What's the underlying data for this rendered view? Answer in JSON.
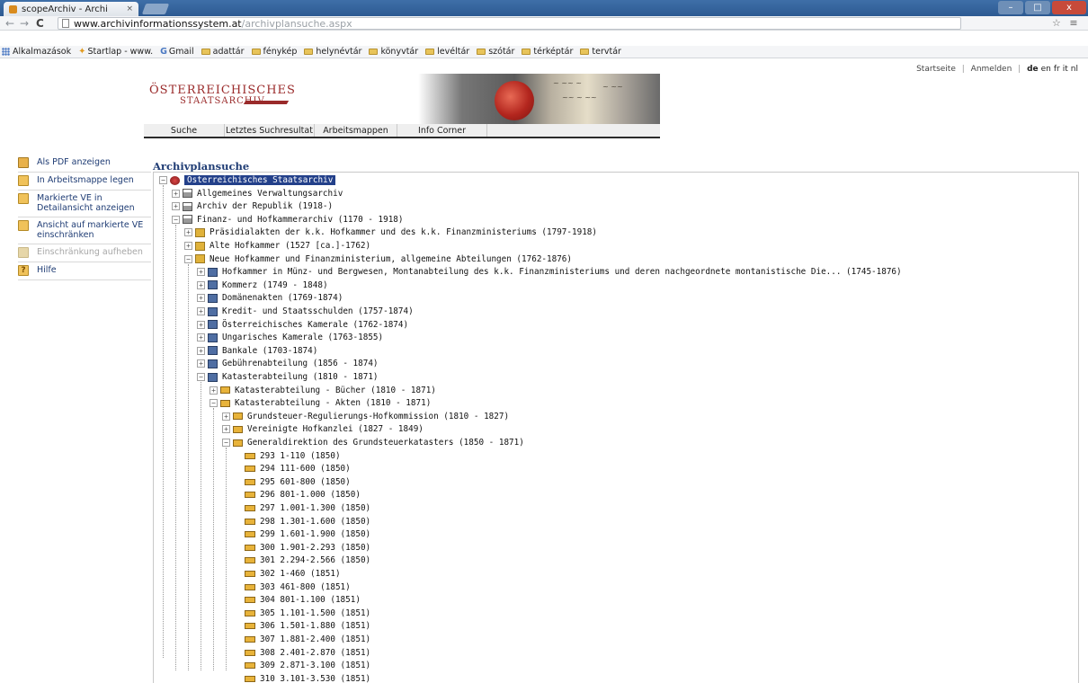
{
  "browser": {
    "tab_title": "scopeArchiv - Archi",
    "tab_close": "×",
    "url_host": "www.archivinformationssystem.at",
    "url_path": "/archivplansuche.aspx",
    "window_controls": {
      "min": "–",
      "max": "□",
      "close": "x"
    },
    "nav_glyphs": {
      "back": "←",
      "forward": "→",
      "reload": "C"
    },
    "toolbar_glyphs": "☆ ≡",
    "bookmarks": [
      {
        "label": "Alkalmazások",
        "icon": "apps-icon"
      },
      {
        "label": "Startlap - www.",
        "icon": "star-icon"
      },
      {
        "label": "Gmail",
        "icon": "google-icon"
      },
      {
        "label": "adattár",
        "icon": "folder-icon"
      },
      {
        "label": "fénykép",
        "icon": "folder-icon"
      },
      {
        "label": "helynévtár",
        "icon": "folder-icon"
      },
      {
        "label": "könyvtár",
        "icon": "folder-icon"
      },
      {
        "label": "levéltár",
        "icon": "folder-icon"
      },
      {
        "label": "szótár",
        "icon": "folder-icon"
      },
      {
        "label": "térképtár",
        "icon": "folder-icon"
      },
      {
        "label": "tervtár",
        "icon": "folder-icon"
      }
    ]
  },
  "header": {
    "startseite": "Startseite",
    "separator": "|",
    "anmelden": "Anmelden",
    "languages": [
      "de",
      "en",
      "fr",
      "it",
      "nl"
    ],
    "active_language": "de",
    "logo_line1": "ÖSTERREICHISCHES",
    "logo_line2": "STAATSARCHIV",
    "nav": [
      "Suche",
      "Letztes Suchresultat",
      "Arbeitsmappen",
      "Info Corner"
    ]
  },
  "sidebar": [
    {
      "label": "Als PDF anzeigen",
      "icon": "pdf-icon",
      "enabled": true
    },
    {
      "label": "In Arbeitsmappe legen",
      "icon": "folder-add-icon",
      "enabled": true
    },
    {
      "label": "Markierte VE in Detailansicht anzeigen",
      "icon": "detail-view-icon",
      "enabled": true
    },
    {
      "label": "Ansicht auf markierte VE einschränken",
      "icon": "filter-icon",
      "enabled": true
    },
    {
      "label": "Einschränkung aufheben",
      "icon": "filter-off-icon",
      "enabled": false
    },
    {
      "label": "Hilfe",
      "icon": "help-icon",
      "enabled": true
    }
  ],
  "main": {
    "title": "Archivplansuche",
    "tree": [
      {
        "depth": 0,
        "exp": "-",
        "icon": "root",
        "label": "Österreichisches Staatsarchiv",
        "selected": true
      },
      {
        "depth": 1,
        "exp": "+",
        "icon": "bldg",
        "label": "Allgemeines Verwaltungsarchiv"
      },
      {
        "depth": 1,
        "exp": "+",
        "icon": "bldg",
        "label": "Archiv der Republik (1918-)"
      },
      {
        "depth": 1,
        "exp": "-",
        "icon": "bldg",
        "label": "Finanz- und Hofkammerarchiv (1170 - 1918)"
      },
      {
        "depth": 2,
        "exp": "+",
        "icon": "gold",
        "label": "Präsidialakten der k.k. Hofkammer und des k.k. Finanzministeriums (1797-1918)"
      },
      {
        "depth": 2,
        "exp": "+",
        "icon": "gold",
        "label": "Alte Hofkammer (1527 [ca.]-1762)"
      },
      {
        "depth": 2,
        "exp": "-",
        "icon": "gold",
        "label": "Neue Hofkammer und Finanzministerium, allgemeine Abteilungen (1762-1876)"
      },
      {
        "depth": 3,
        "exp": "+",
        "icon": "blue",
        "label": "Hofkammer in Münz- und Bergwesen, Montanabteilung des k.k. Finanzministeriums und deren nachgeordnete montanistische Die... (1745-1876)"
      },
      {
        "depth": 3,
        "exp": "+",
        "icon": "blue",
        "label": "Kommerz (1749 - 1848)"
      },
      {
        "depth": 3,
        "exp": "+",
        "icon": "blue",
        "label": "Domänenakten (1769-1874)"
      },
      {
        "depth": 3,
        "exp": "+",
        "icon": "blue",
        "label": "Kredit- und Staatsschulden (1757-1874)"
      },
      {
        "depth": 3,
        "exp": "+",
        "icon": "blue",
        "label": "Österreichisches Kamerale (1762-1874)"
      },
      {
        "depth": 3,
        "exp": "+",
        "icon": "blue",
        "label": "Ungarisches Kamerale (1763-1855)"
      },
      {
        "depth": 3,
        "exp": "+",
        "icon": "blue",
        "label": "Bankale (1703-1874)"
      },
      {
        "depth": 3,
        "exp": "+",
        "icon": "blue",
        "label": "Gebührenabteilung (1856 - 1874)"
      },
      {
        "depth": 3,
        "exp": "-",
        "icon": "blue",
        "label": "Katasterabteilung (1810 - 1871)"
      },
      {
        "depth": 4,
        "exp": "+",
        "icon": "box",
        "label": "Katasterabteilung - Bücher (1810 - 1871)"
      },
      {
        "depth": 4,
        "exp": "-",
        "icon": "box",
        "label": "Katasterabteilung - Akten (1810 - 1871)"
      },
      {
        "depth": 5,
        "exp": "+",
        "icon": "box",
        "label": "Grundsteuer-Regulierungs-Hofkommission (1810 - 1827)"
      },
      {
        "depth": 5,
        "exp": "+",
        "icon": "box",
        "label": "Vereinigte Hofkanzlei (1827 - 1849)"
      },
      {
        "depth": 5,
        "exp": "-",
        "icon": "box",
        "label": "Generaldirektion des Grundsteuerkatasters (1850 - 1871)"
      },
      {
        "depth": 6,
        "exp": "",
        "icon": "file",
        "label": "293 1-110 (1850)"
      },
      {
        "depth": 6,
        "exp": "",
        "icon": "file",
        "label": "294 111-600 (1850)"
      },
      {
        "depth": 6,
        "exp": "",
        "icon": "file",
        "label": "295 601-800 (1850)"
      },
      {
        "depth": 6,
        "exp": "",
        "icon": "file",
        "label": "296 801-1.000 (1850)"
      },
      {
        "depth": 6,
        "exp": "",
        "icon": "file",
        "label": "297 1.001-1.300 (1850)"
      },
      {
        "depth": 6,
        "exp": "",
        "icon": "file",
        "label": "298 1.301-1.600 (1850)"
      },
      {
        "depth": 6,
        "exp": "",
        "icon": "file",
        "label": "299 1.601-1.900 (1850)"
      },
      {
        "depth": 6,
        "exp": "",
        "icon": "file",
        "label": "300 1.901-2.293 (1850)"
      },
      {
        "depth": 6,
        "exp": "",
        "icon": "file",
        "label": "301 2.294-2.566 (1850)"
      },
      {
        "depth": 6,
        "exp": "",
        "icon": "file",
        "label": "302 1-460 (1851)"
      },
      {
        "depth": 6,
        "exp": "",
        "icon": "file",
        "label": "303 461-800 (1851)"
      },
      {
        "depth": 6,
        "exp": "",
        "icon": "file",
        "label": "304 801-1.100 (1851)"
      },
      {
        "depth": 6,
        "exp": "",
        "icon": "file",
        "label": "305 1.101-1.500 (1851)"
      },
      {
        "depth": 6,
        "exp": "",
        "icon": "file",
        "label": "306 1.501-1.880 (1851)"
      },
      {
        "depth": 6,
        "exp": "",
        "icon": "file",
        "label": "307 1.881-2.400 (1851)"
      },
      {
        "depth": 6,
        "exp": "",
        "icon": "file",
        "label": "308 2.401-2.870 (1851)"
      },
      {
        "depth": 6,
        "exp": "",
        "icon": "file",
        "label": "309 2.871-3.100 (1851)"
      },
      {
        "depth": 6,
        "exp": "",
        "icon": "file",
        "label": "310 3.101-3.530 (1851)"
      }
    ]
  },
  "colors": {
    "link": "#1f3c74",
    "selected": "#23408a",
    "brand": "#9a2a2a"
  }
}
